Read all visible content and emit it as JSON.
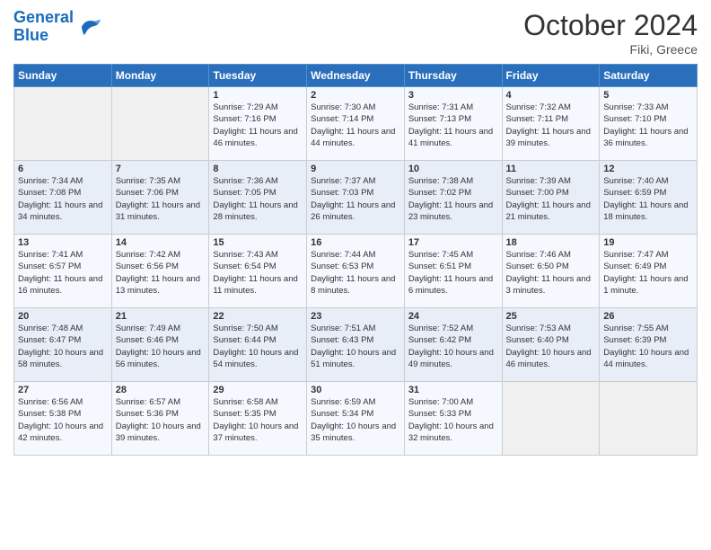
{
  "header": {
    "logo_line1": "General",
    "logo_line2": "Blue",
    "month": "October 2024",
    "location": "Fiki, Greece"
  },
  "columns": [
    "Sunday",
    "Monday",
    "Tuesday",
    "Wednesday",
    "Thursday",
    "Friday",
    "Saturday"
  ],
  "weeks": [
    [
      {
        "day": "",
        "info": ""
      },
      {
        "day": "",
        "info": ""
      },
      {
        "day": "1",
        "info": "Sunrise: 7:29 AM\nSunset: 7:16 PM\nDaylight: 11 hours and 46 minutes."
      },
      {
        "day": "2",
        "info": "Sunrise: 7:30 AM\nSunset: 7:14 PM\nDaylight: 11 hours and 44 minutes."
      },
      {
        "day": "3",
        "info": "Sunrise: 7:31 AM\nSunset: 7:13 PM\nDaylight: 11 hours and 41 minutes."
      },
      {
        "day": "4",
        "info": "Sunrise: 7:32 AM\nSunset: 7:11 PM\nDaylight: 11 hours and 39 minutes."
      },
      {
        "day": "5",
        "info": "Sunrise: 7:33 AM\nSunset: 7:10 PM\nDaylight: 11 hours and 36 minutes."
      }
    ],
    [
      {
        "day": "6",
        "info": "Sunrise: 7:34 AM\nSunset: 7:08 PM\nDaylight: 11 hours and 34 minutes."
      },
      {
        "day": "7",
        "info": "Sunrise: 7:35 AM\nSunset: 7:06 PM\nDaylight: 11 hours and 31 minutes."
      },
      {
        "day": "8",
        "info": "Sunrise: 7:36 AM\nSunset: 7:05 PM\nDaylight: 11 hours and 28 minutes."
      },
      {
        "day": "9",
        "info": "Sunrise: 7:37 AM\nSunset: 7:03 PM\nDaylight: 11 hours and 26 minutes."
      },
      {
        "day": "10",
        "info": "Sunrise: 7:38 AM\nSunset: 7:02 PM\nDaylight: 11 hours and 23 minutes."
      },
      {
        "day": "11",
        "info": "Sunrise: 7:39 AM\nSunset: 7:00 PM\nDaylight: 11 hours and 21 minutes."
      },
      {
        "day": "12",
        "info": "Sunrise: 7:40 AM\nSunset: 6:59 PM\nDaylight: 11 hours and 18 minutes."
      }
    ],
    [
      {
        "day": "13",
        "info": "Sunrise: 7:41 AM\nSunset: 6:57 PM\nDaylight: 11 hours and 16 minutes."
      },
      {
        "day": "14",
        "info": "Sunrise: 7:42 AM\nSunset: 6:56 PM\nDaylight: 11 hours and 13 minutes."
      },
      {
        "day": "15",
        "info": "Sunrise: 7:43 AM\nSunset: 6:54 PM\nDaylight: 11 hours and 11 minutes."
      },
      {
        "day": "16",
        "info": "Sunrise: 7:44 AM\nSunset: 6:53 PM\nDaylight: 11 hours and 8 minutes."
      },
      {
        "day": "17",
        "info": "Sunrise: 7:45 AM\nSunset: 6:51 PM\nDaylight: 11 hours and 6 minutes."
      },
      {
        "day": "18",
        "info": "Sunrise: 7:46 AM\nSunset: 6:50 PM\nDaylight: 11 hours and 3 minutes."
      },
      {
        "day": "19",
        "info": "Sunrise: 7:47 AM\nSunset: 6:49 PM\nDaylight: 11 hours and 1 minute."
      }
    ],
    [
      {
        "day": "20",
        "info": "Sunrise: 7:48 AM\nSunset: 6:47 PM\nDaylight: 10 hours and 58 minutes."
      },
      {
        "day": "21",
        "info": "Sunrise: 7:49 AM\nSunset: 6:46 PM\nDaylight: 10 hours and 56 minutes."
      },
      {
        "day": "22",
        "info": "Sunrise: 7:50 AM\nSunset: 6:44 PM\nDaylight: 10 hours and 54 minutes."
      },
      {
        "day": "23",
        "info": "Sunrise: 7:51 AM\nSunset: 6:43 PM\nDaylight: 10 hours and 51 minutes."
      },
      {
        "day": "24",
        "info": "Sunrise: 7:52 AM\nSunset: 6:42 PM\nDaylight: 10 hours and 49 minutes."
      },
      {
        "day": "25",
        "info": "Sunrise: 7:53 AM\nSunset: 6:40 PM\nDaylight: 10 hours and 46 minutes."
      },
      {
        "day": "26",
        "info": "Sunrise: 7:55 AM\nSunset: 6:39 PM\nDaylight: 10 hours and 44 minutes."
      }
    ],
    [
      {
        "day": "27",
        "info": "Sunrise: 6:56 AM\nSunset: 5:38 PM\nDaylight: 10 hours and 42 minutes."
      },
      {
        "day": "28",
        "info": "Sunrise: 6:57 AM\nSunset: 5:36 PM\nDaylight: 10 hours and 39 minutes."
      },
      {
        "day": "29",
        "info": "Sunrise: 6:58 AM\nSunset: 5:35 PM\nDaylight: 10 hours and 37 minutes."
      },
      {
        "day": "30",
        "info": "Sunrise: 6:59 AM\nSunset: 5:34 PM\nDaylight: 10 hours and 35 minutes."
      },
      {
        "day": "31",
        "info": "Sunrise: 7:00 AM\nSunset: 5:33 PM\nDaylight: 10 hours and 32 minutes."
      },
      {
        "day": "",
        "info": ""
      },
      {
        "day": "",
        "info": ""
      }
    ]
  ]
}
